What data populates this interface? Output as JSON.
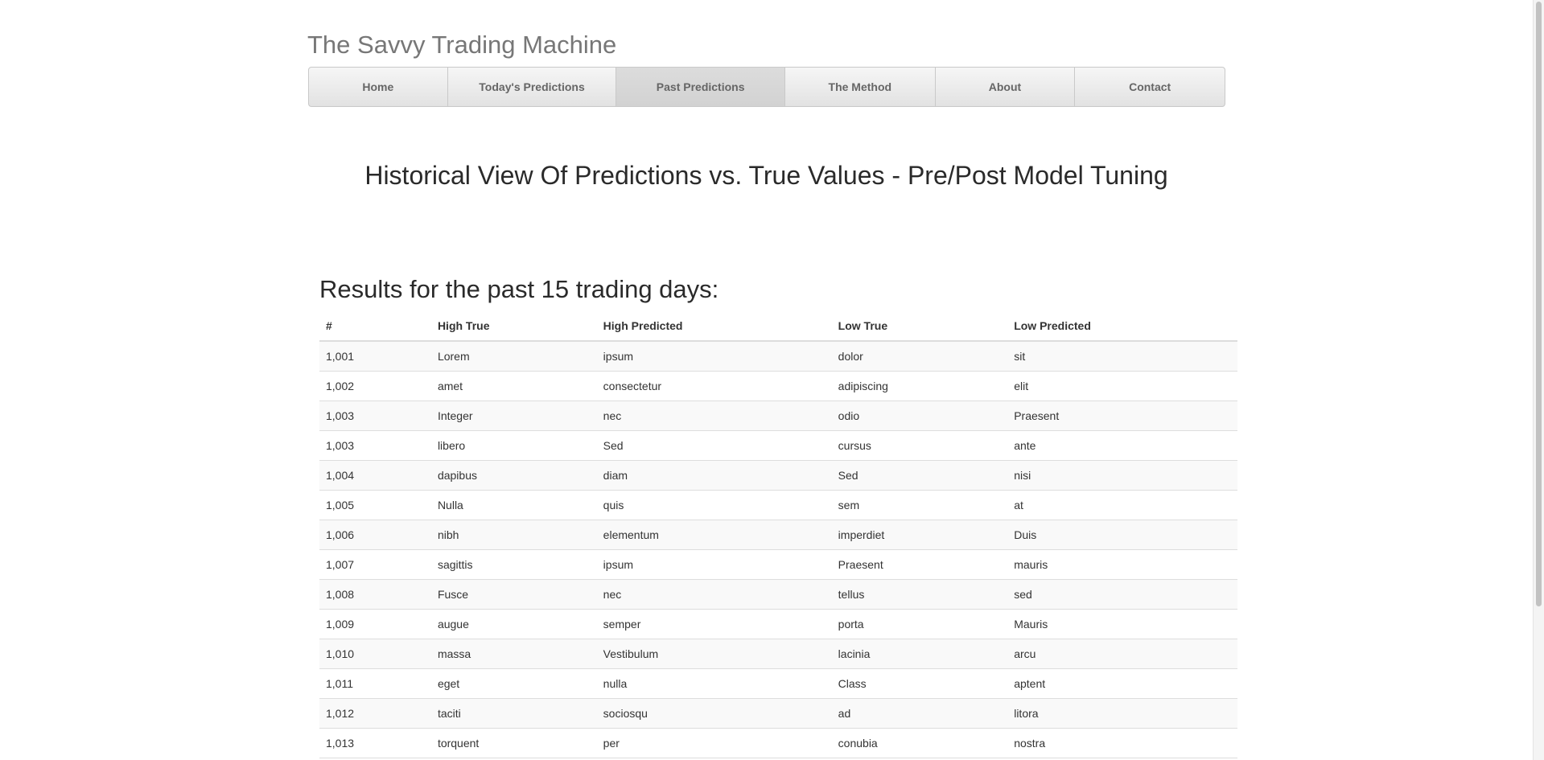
{
  "site": {
    "title": "The Savvy Trading Machine"
  },
  "nav": {
    "items": [
      {
        "label": "Home",
        "active": false
      },
      {
        "label": "Today's Predictions",
        "active": false
      },
      {
        "label": "Past Predictions",
        "active": true
      },
      {
        "label": "The Method",
        "active": false
      },
      {
        "label": "About",
        "active": false
      },
      {
        "label": "Contact",
        "active": false
      }
    ]
  },
  "main": {
    "heading": "Historical View Of Predictions vs. True Values - Pre/Post Model Tuning",
    "results_heading": "Results for the past 15 trading days:"
  },
  "table": {
    "columns": [
      "#",
      "High True",
      "High Predicted",
      "Low True",
      "Low Predicted"
    ],
    "rows": [
      [
        "1,001",
        "Lorem",
        "ipsum",
        "dolor",
        "sit"
      ],
      [
        "1,002",
        "amet",
        "consectetur",
        "adipiscing",
        "elit"
      ],
      [
        "1,003",
        "Integer",
        "nec",
        "odio",
        "Praesent"
      ],
      [
        "1,003",
        "libero",
        "Sed",
        "cursus",
        "ante"
      ],
      [
        "1,004",
        "dapibus",
        "diam",
        "Sed",
        "nisi"
      ],
      [
        "1,005",
        "Nulla",
        "quis",
        "sem",
        "at"
      ],
      [
        "1,006",
        "nibh",
        "elementum",
        "imperdiet",
        "Duis"
      ],
      [
        "1,007",
        "sagittis",
        "ipsum",
        "Praesent",
        "mauris"
      ],
      [
        "1,008",
        "Fusce",
        "nec",
        "tellus",
        "sed"
      ],
      [
        "1,009",
        "augue",
        "semper",
        "porta",
        "Mauris"
      ],
      [
        "1,010",
        "massa",
        "Vestibulum",
        "lacinia",
        "arcu"
      ],
      [
        "1,011",
        "eget",
        "nulla",
        "Class",
        "aptent"
      ],
      [
        "1,012",
        "taciti",
        "sociosqu",
        "ad",
        "litora"
      ],
      [
        "1,013",
        "torquent",
        "per",
        "conubia",
        "nostra"
      ]
    ]
  }
}
